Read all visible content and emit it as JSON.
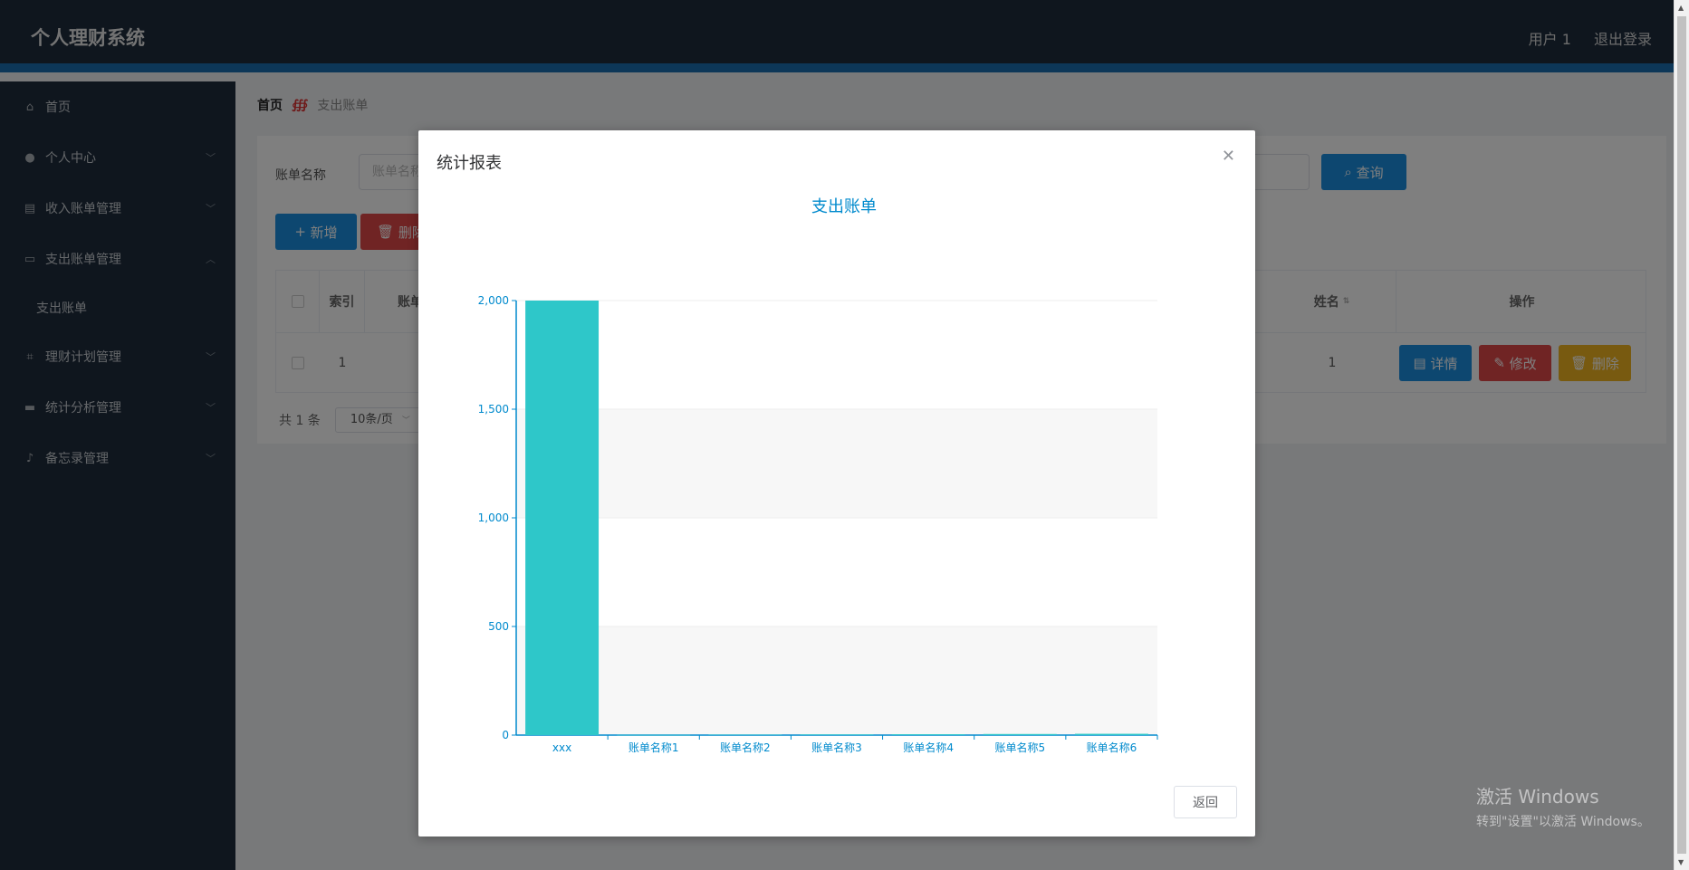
{
  "app": {
    "title": "个人理财系统"
  },
  "header": {
    "user": "用户 1",
    "logout": "退出登录"
  },
  "sidebar": {
    "items": [
      {
        "label": "首页",
        "icon": "home-icon"
      },
      {
        "label": "个人中心",
        "icon": "user-icon"
      },
      {
        "label": "收入账单管理",
        "icon": "clipboard-icon"
      },
      {
        "label": "支出账单管理",
        "icon": "card-icon"
      },
      {
        "label": "支出账单",
        "icon": ""
      },
      {
        "label": "理财计划管理",
        "icon": "crop-icon"
      },
      {
        "label": "统计分析管理",
        "icon": "briefcase-icon"
      },
      {
        "label": "备忘录管理",
        "icon": "microphone-icon"
      }
    ]
  },
  "breadcrumb": {
    "home": "首页",
    "current": "支出账单"
  },
  "search": {
    "label": "账单名称",
    "placeholder": "账单名称",
    "query_label": "查询"
  },
  "toolbar": {
    "add_label": "新增",
    "delete_label": "删除"
  },
  "table": {
    "headers": {
      "index": "索引",
      "name_partial": "账单",
      "surname": "姓名",
      "actions": "操作"
    },
    "rows": [
      {
        "index": "1",
        "surname": "1"
      }
    ],
    "row_actions": {
      "detail": "详情",
      "edit": "修改",
      "delete": "删除"
    }
  },
  "pagination": {
    "total": "共 1 条",
    "page_size": "10条/页"
  },
  "modal": {
    "title": "统计报表",
    "back_label": "返回"
  },
  "chart_data": {
    "type": "bar",
    "title": "支出账单",
    "categories": [
      "xxx",
      "账单名称1",
      "账单名称2",
      "账单名称3",
      "账单名称4",
      "账单名称5",
      "账单名称6"
    ],
    "values": [
      2000,
      1,
      2,
      3,
      4,
      5,
      6
    ],
    "ylim": [
      0,
      2000
    ],
    "yticks": [
      0,
      500,
      1000,
      1500,
      2000
    ],
    "ytick_labels": [
      "0",
      "500",
      "1,000",
      "1,500",
      "2,000"
    ],
    "bar_color": "#2ec7c9",
    "axis_color": "#008acd",
    "grid": true
  },
  "watermark": {
    "line1": "激活 Windows",
    "line2": "转到\"设置\"以激活 Windows。"
  }
}
